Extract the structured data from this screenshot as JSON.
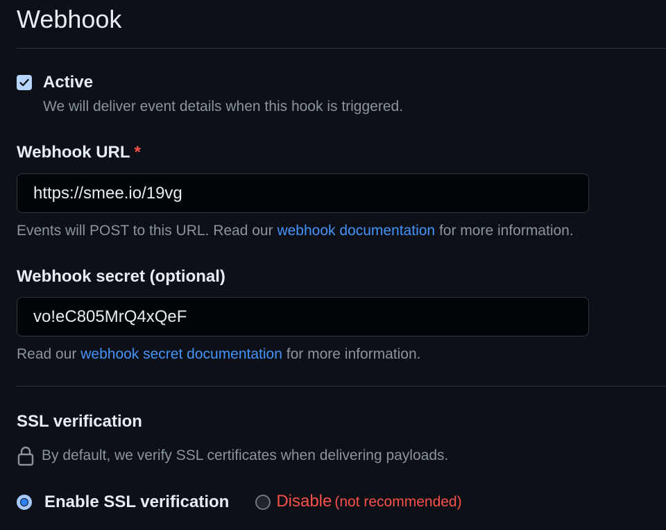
{
  "section": {
    "title": "Webhook"
  },
  "active": {
    "checked": true,
    "label": "Active",
    "note": "We will deliver event details when this hook is triggered."
  },
  "url_field": {
    "label": "Webhook URL",
    "required_marker": "*",
    "value": "https://smee.io/19vg",
    "help_before": "Events will POST to this URL. Read our ",
    "help_link": "webhook documentation",
    "help_after": " for more information."
  },
  "secret_field": {
    "label": "Webhook secret (optional)",
    "value": "vo!eC805MrQ4xQeF",
    "help_before": "Read our ",
    "help_link": "webhook secret documentation",
    "help_after": " for more information."
  },
  "ssl": {
    "title": "SSL verification",
    "note": "By default, we verify SSL certificates when delivering payloads.",
    "lock_icon": "lock-icon",
    "options": {
      "enable_label": "Enable SSL verification",
      "disable_label": "Disable",
      "disable_note": "(not recommended)",
      "selected": "enable"
    }
  },
  "colors": {
    "background": "#0d1117",
    "link": "#4493f8",
    "danger": "#f85149",
    "muted": "#8b949e"
  }
}
